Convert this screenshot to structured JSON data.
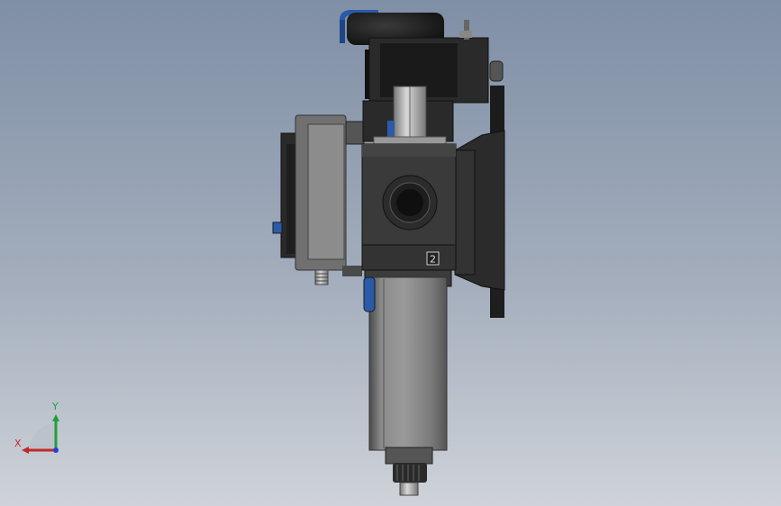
{
  "viewport": {
    "background_top": "#7f8fa6",
    "background_bottom": "#cfd3d9"
  },
  "model": {
    "port_marking": "2",
    "body_color": "#3c3c3c",
    "accent_color": "#2a5aa8"
  },
  "triad": {
    "x_label": "X",
    "y_label": "Y",
    "x_color": "#c0282a",
    "y_color": "#1ea03c",
    "z_color": "#2a3fd0"
  }
}
